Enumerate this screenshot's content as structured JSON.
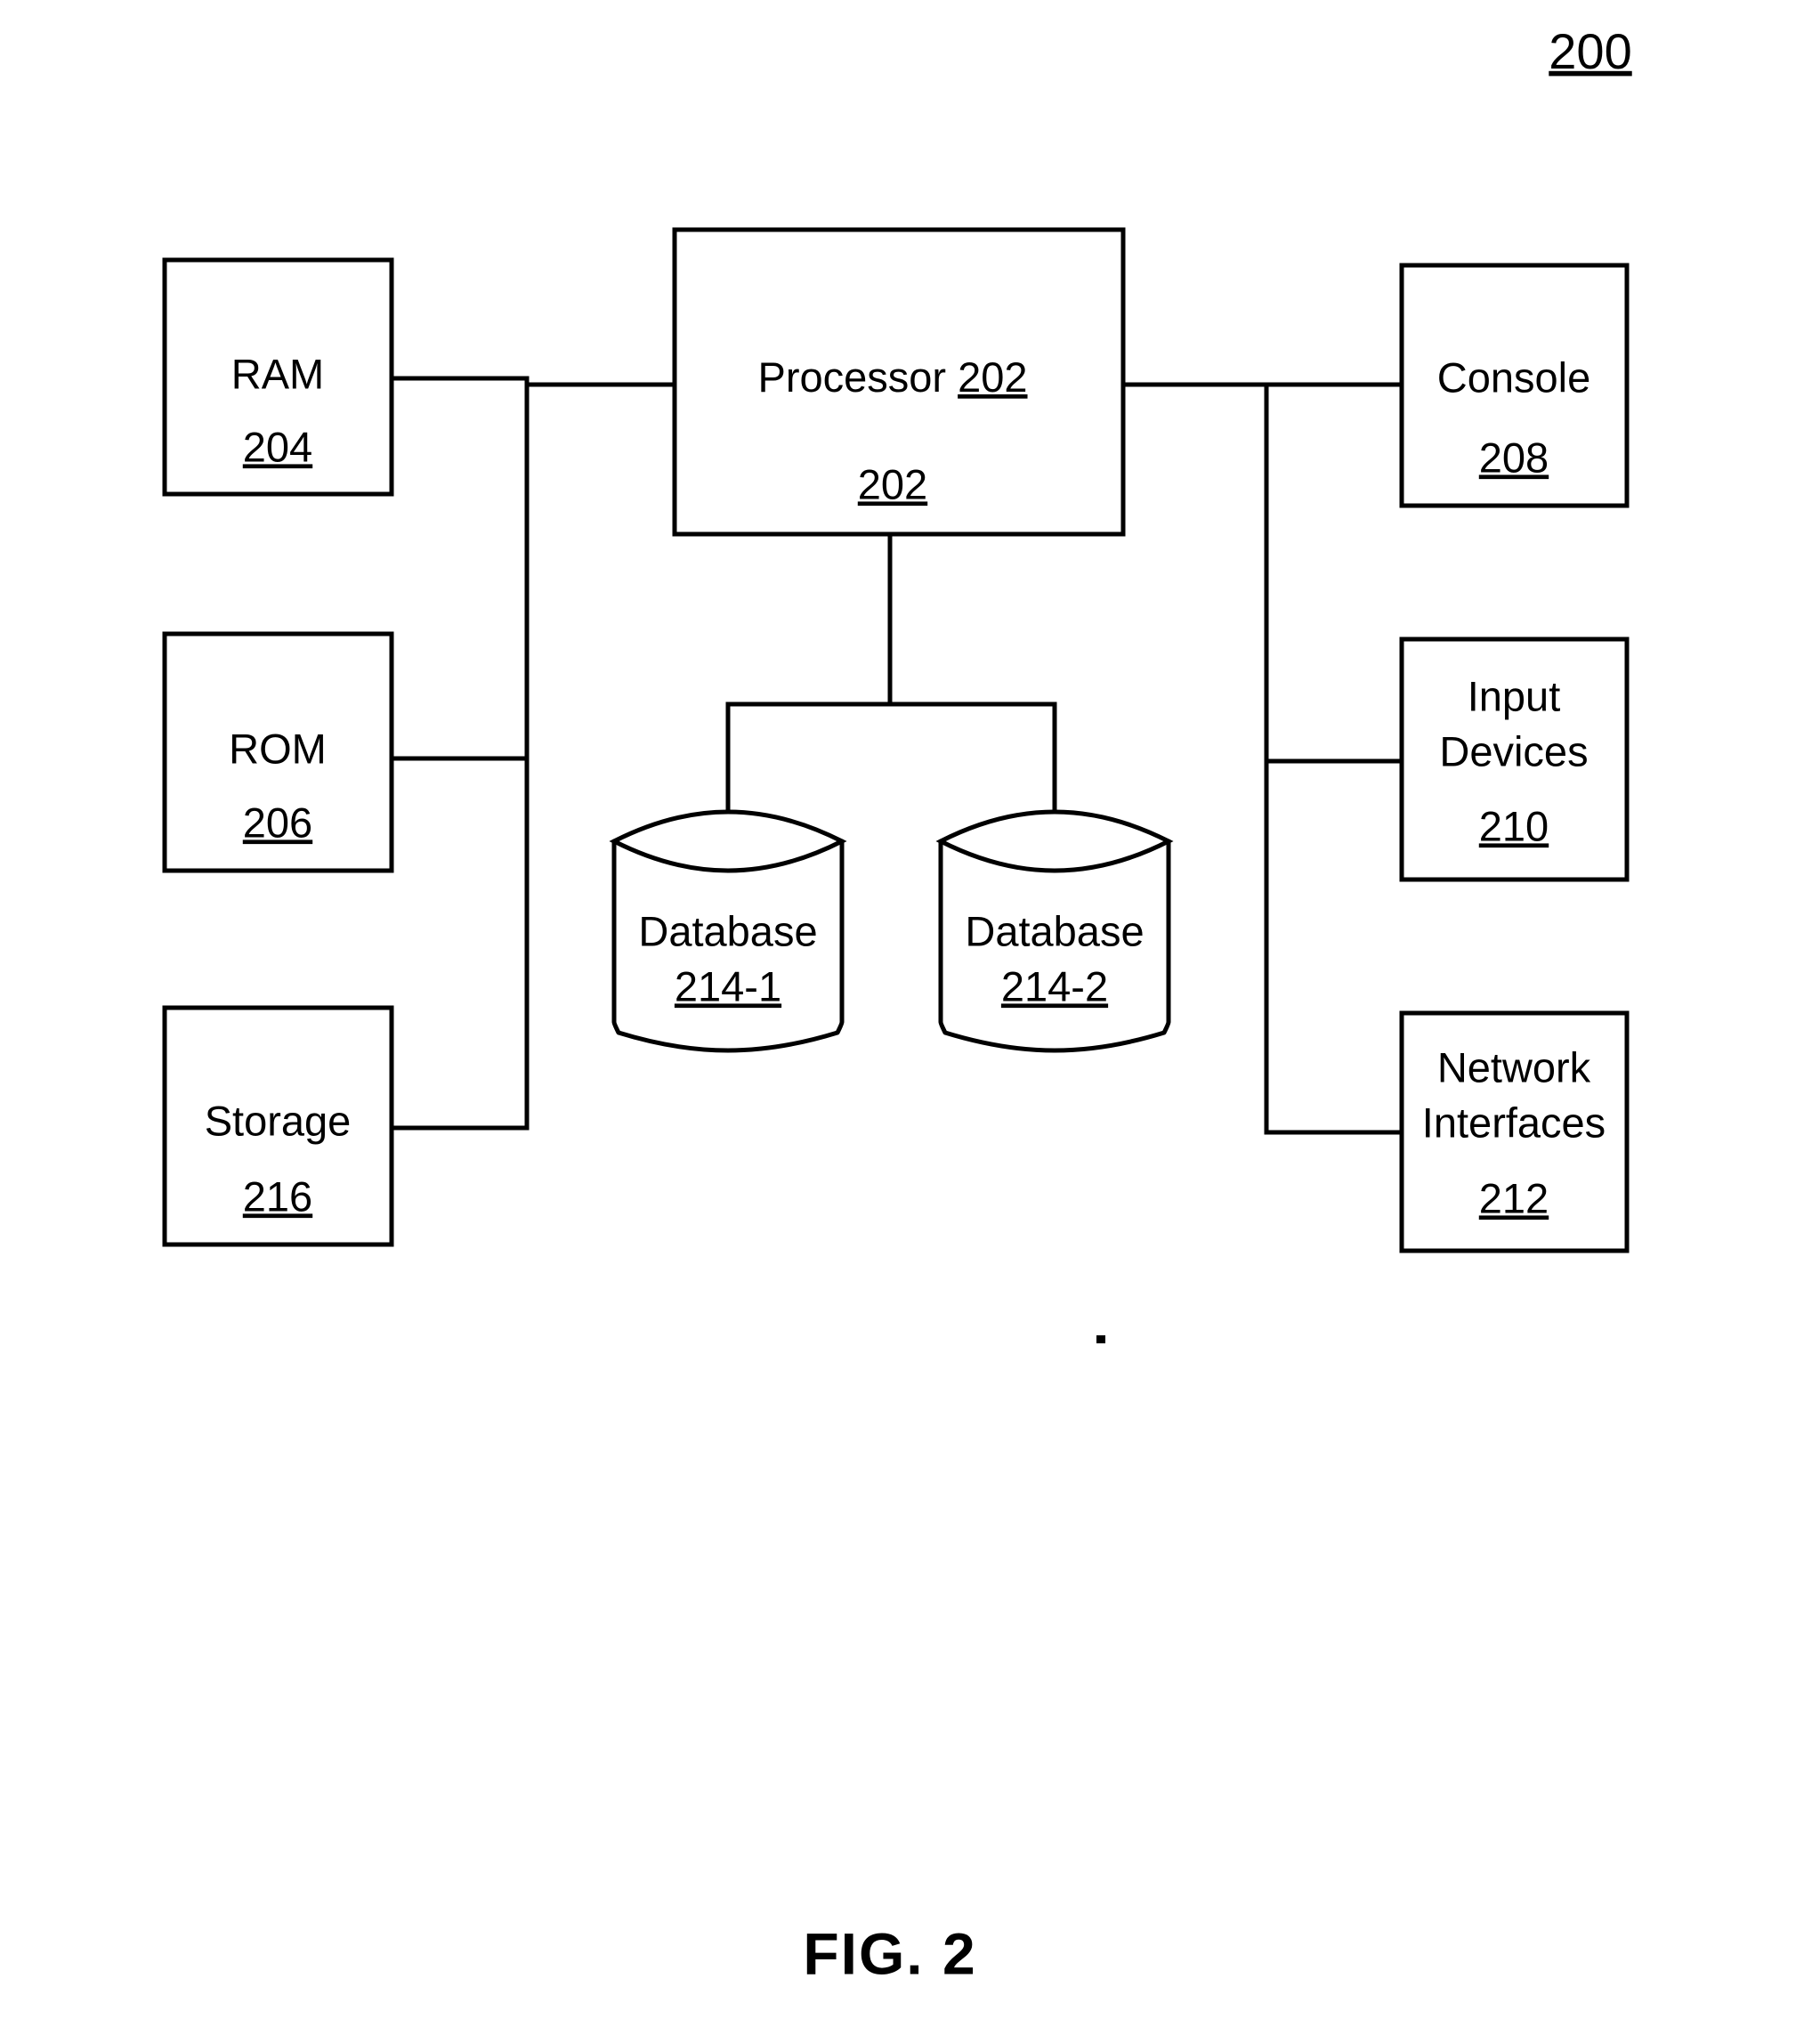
{
  "figure": {
    "number_label": "200",
    "caption": "FIG. 2"
  },
  "nodes": {
    "processor": {
      "title": "Processor 202",
      "title_text": "Processor",
      "title_ref": "202",
      "ref": "202"
    },
    "ram": {
      "title": "RAM",
      "ref": "204"
    },
    "rom": {
      "title": "ROM",
      "ref": "206"
    },
    "storage": {
      "title": "Storage",
      "ref": "216"
    },
    "console": {
      "title": "Console",
      "ref": "208"
    },
    "input_devices": {
      "line1": "Input",
      "line2": "Devices",
      "ref": "210"
    },
    "network_interfaces": {
      "line1": "Network",
      "line2": "Interfaces",
      "ref": "212"
    },
    "database_1": {
      "title": "Database",
      "ref": "214-1"
    },
    "database_2": {
      "title": "Database",
      "ref": "214-2"
    }
  },
  "colors": {
    "stroke": "#000000",
    "fill": "#ffffff",
    "text": "#000000"
  }
}
